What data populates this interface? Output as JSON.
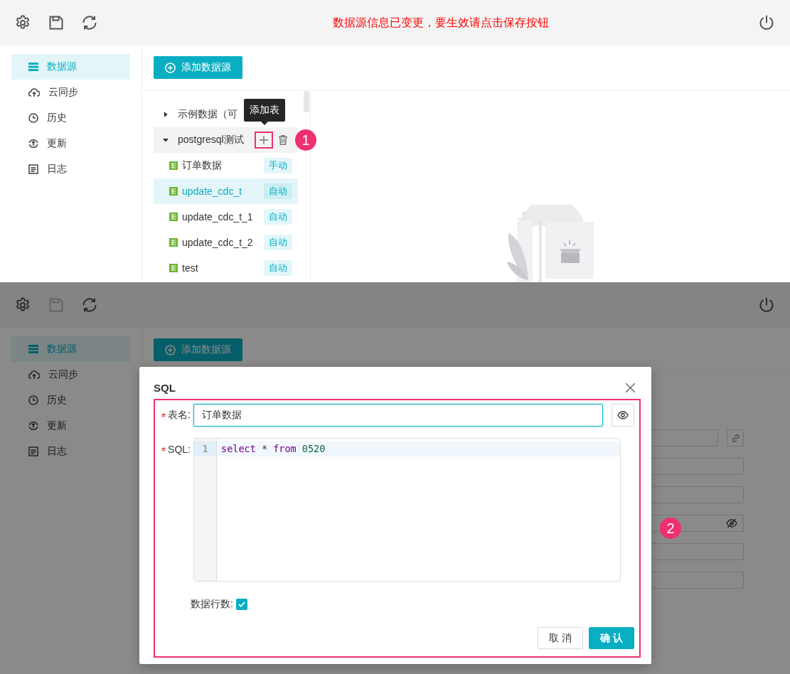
{
  "screen_1": {
    "toolbar": {
      "save_disabled": false,
      "notice": "数据源信息已变更，要生效请点击保存按钮"
    },
    "sidebar": {
      "items": [
        {
          "label": "数据源",
          "selected": true
        },
        {
          "label": "云同步",
          "selected": false
        },
        {
          "label": "历史",
          "selected": false
        },
        {
          "label": "更新",
          "selected": false
        },
        {
          "label": "日志",
          "selected": false
        }
      ]
    },
    "add_source_button": "添加数据源",
    "tree": {
      "items": [
        {
          "label": "示例数据（可",
          "expanded": false,
          "hovered": false
        },
        {
          "label": "postgresql测试",
          "expanded": true,
          "hovered": true,
          "children": [
            {
              "label": "订单数据",
              "tag": "手动",
              "selected": false
            },
            {
              "label": "update_cdc_t",
              "tag": "自动",
              "selected": true
            },
            {
              "label": "update_cdc_t_1",
              "tag": "自动",
              "selected": false
            },
            {
              "label": "update_cdc_t_2",
              "tag": "自动",
              "selected": false
            },
            {
              "label": "test",
              "tag": "自动",
              "selected": false
            }
          ]
        }
      ]
    },
    "tooltip": "添加表",
    "step_badge": "1"
  },
  "screen_2": {
    "toolbar": {
      "save_disabled": true
    },
    "sidebar": {
      "items": [
        {
          "label": "数据源",
          "selected": true
        },
        {
          "label": "云同步",
          "selected": false
        },
        {
          "label": "历史",
          "selected": false
        },
        {
          "label": "更新",
          "selected": false
        },
        {
          "label": "日志",
          "selected": false
        }
      ]
    },
    "add_source_button": "添加数据源",
    "dialog": {
      "title": "SQL",
      "table_name": {
        "label": "表名:",
        "required": true,
        "value": "订单数据"
      },
      "sql": {
        "label": "SQL:",
        "required": true,
        "lines": [
          {
            "number": "1",
            "tokens": [
              {
                "text": "select",
                "kind": "keyword"
              },
              {
                "text": "*",
                "kind": "operator"
              },
              {
                "text": "from",
                "kind": "keyword"
              },
              {
                "text": "0520",
                "kind": "number"
              }
            ]
          }
        ]
      },
      "row_count": {
        "label": "数据行数:",
        "checked": true
      },
      "buttons": [
        {
          "label": "取 消",
          "kind": "default"
        },
        {
          "label": "确 认",
          "kind": "primary"
        }
      ]
    },
    "step_badge": "2"
  }
}
